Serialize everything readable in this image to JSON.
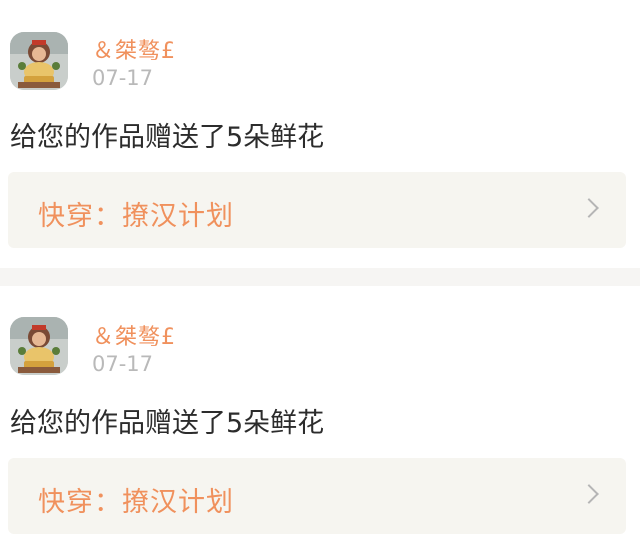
{
  "notifications": [
    {
      "username": "＆桀骜£",
      "date": "07-17",
      "message": "给您的作品赠送了5朵鲜花",
      "work_title": "快穿：撩汉计划",
      "avatar_icon": "user-avatar-image",
      "chevron_icon": "chevron-right-icon"
    },
    {
      "username": "＆桀骜£",
      "date": "07-17",
      "message": "给您的作品赠送了5朵鲜花",
      "work_title": "快穿：撩汉计划",
      "avatar_icon": "user-avatar-image",
      "chevron_icon": "chevron-right-icon"
    }
  ],
  "colors": {
    "accent": "#f0915d",
    "date_gray": "#b9b9b9",
    "text": "#2c2c2c",
    "link_bg": "#f6f5f0",
    "separator": "#f6f5f3"
  }
}
